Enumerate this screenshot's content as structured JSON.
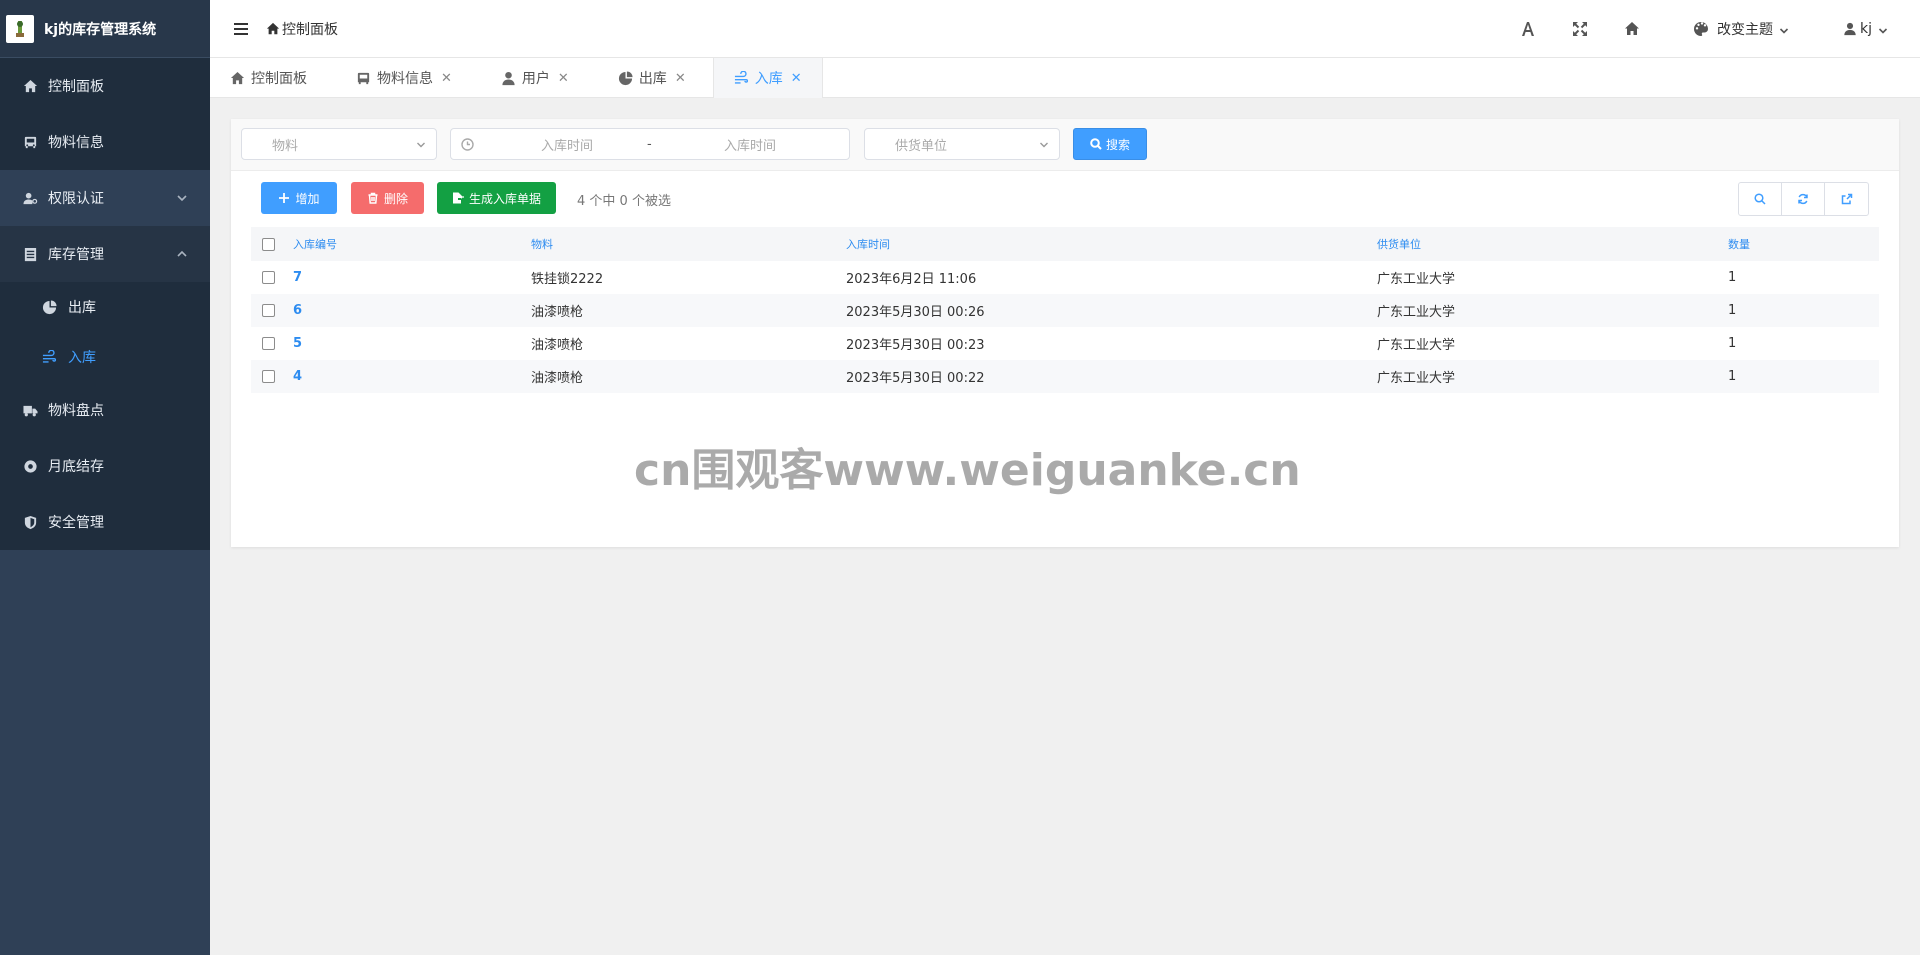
{
  "app": {
    "title": "kj的库存管理系统"
  },
  "sidebar": {
    "items": [
      {
        "label": "控制面板",
        "icon": "home-icon"
      },
      {
        "label": "物料信息",
        "icon": "bus-icon"
      },
      {
        "label": "权限认证",
        "icon": "user-key-icon",
        "expanded": false
      },
      {
        "label": "库存管理",
        "icon": "list-icon",
        "expanded": true
      },
      {
        "label": "物料盘点",
        "icon": "truck-icon"
      },
      {
        "label": "月底结存",
        "icon": "circle-icon"
      },
      {
        "label": "安全管理",
        "icon": "shield-icon"
      }
    ],
    "submenu": [
      {
        "label": "出库",
        "icon": "pie-icon",
        "active": false
      },
      {
        "label": "入库",
        "icon": "wind-icon",
        "active": true
      }
    ]
  },
  "header": {
    "breadcrumb": "控制面板",
    "theme_label": "改变主题",
    "user_name": "kj"
  },
  "tabs": [
    {
      "label": "控制面板",
      "icon": "home-icon",
      "closable": false
    },
    {
      "label": "物料信息",
      "icon": "bus-icon",
      "closable": true
    },
    {
      "label": "用户",
      "icon": "user-icon",
      "closable": true
    },
    {
      "label": "出库",
      "icon": "pie-icon",
      "closable": true
    },
    {
      "label": "入库",
      "icon": "wind-icon",
      "closable": true,
      "active": true
    }
  ],
  "search": {
    "material_placeholder": "物料",
    "date_start_placeholder": "入库时间",
    "date_separator": "-",
    "date_end_placeholder": "入库时间",
    "supplier_placeholder": "供货单位",
    "search_label": "搜索"
  },
  "toolbar": {
    "add_label": "增加",
    "delete_label": "删除",
    "generate_label": "生成入库单据",
    "selection_info": "4 个中 0 个被选"
  },
  "table": {
    "columns": [
      "入库编号",
      "物料",
      "入库时间",
      "供货单位",
      "数量"
    ],
    "rows": [
      {
        "id": "7",
        "material": "铁挂锁2222",
        "time": "2023年6月2日 11:06",
        "supplier": "广东工业大学",
        "qty": "1"
      },
      {
        "id": "6",
        "material": "油漆喷枪",
        "time": "2023年5月30日 00:26",
        "supplier": "广东工业大学",
        "qty": "1"
      },
      {
        "id": "5",
        "material": "油漆喷枪",
        "time": "2023年5月30日 00:23",
        "supplier": "广东工业大学",
        "qty": "1"
      },
      {
        "id": "4",
        "material": "油漆喷枪",
        "time": "2023年5月30日 00:22",
        "supplier": "广东工业大学",
        "qty": "1"
      }
    ]
  },
  "watermark": "cn围观客www.weiguanke.cn",
  "colors": {
    "sidebar_bg": "#2f4056",
    "accent": "#409eff",
    "danger": "#f56c6c",
    "success": "#13a043"
  }
}
